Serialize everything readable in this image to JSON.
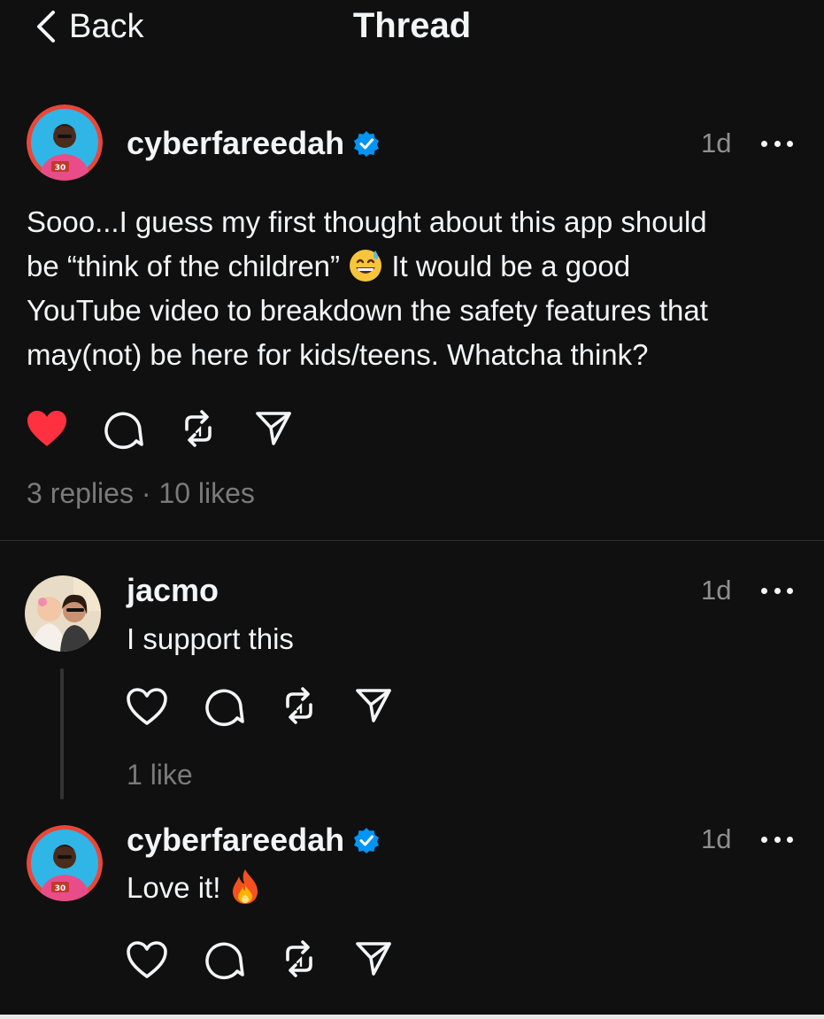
{
  "header": {
    "back_label": "Back",
    "title": "Thread"
  },
  "main_post": {
    "username": "cyberfareedah",
    "verified": true,
    "time": "1d",
    "text_line1": "Sooo...I guess my first thought about this app should",
    "text_line2a": "be “think of the children”",
    "text_line2b": "It would be a good",
    "text_line3": "YouTube video to breakdown the safety features that",
    "text_line4": "may(not) be here for kids/teens. Whatcha think?",
    "emoji": "grinning-face-with-sweat",
    "liked": true,
    "stats": "3 replies · 10 likes"
  },
  "replies": [
    {
      "username": "jacmo",
      "verified": false,
      "time": "1d",
      "text": "I support this",
      "liked": false,
      "stats": "1 like"
    },
    {
      "username": "cyberfareedah",
      "verified": true,
      "time": "1d",
      "text": "Love it!",
      "emoji": "fire",
      "liked": false,
      "stats": ""
    }
  ],
  "colors": {
    "background": "#101010",
    "like_red": "#ff3040",
    "verified_blue": "#0095f6",
    "muted": "#7a7a7a"
  },
  "icons": [
    "chevron-left-icon",
    "verified-badge-icon",
    "more-icon",
    "heart-icon",
    "comment-icon",
    "repost-icon",
    "share-icon"
  ]
}
